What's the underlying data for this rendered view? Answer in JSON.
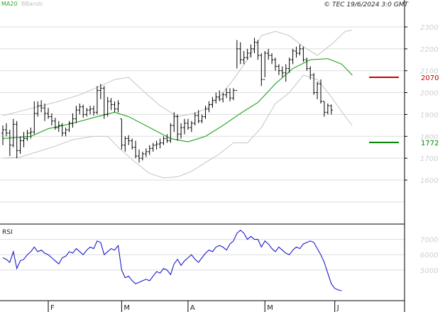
{
  "chart_data": {
    "type": "stock-chart",
    "legend": [
      {
        "label": "MA20",
        "color": "#2ea82e"
      },
      {
        "label": "BBands",
        "color": "#bfbfbf"
      }
    ],
    "header": "© TEC 19/6/2024 3:0 GMT",
    "price_axis": {
      "ticks": [
        1600,
        1700,
        1800,
        1900,
        2000,
        2100,
        2200,
        2300
      ],
      "ylim": [
        1490,
        2340
      ]
    },
    "x_axis": {
      "ticks": [
        "F",
        "M",
        "A",
        "M",
        "J"
      ],
      "tick_index": [
        13,
        34,
        53,
        75,
        95
      ],
      "n_bars": 105
    },
    "levels": [
      {
        "value": 2070,
        "label": "2070",
        "color": "#cc0000"
      },
      {
        "value": 1772,
        "label": "1772",
        "color": "#008000"
      }
    ],
    "rsi": {
      "label": "RSI",
      "ticks": [
        5000,
        6000,
        7000
      ],
      "ylim": [
        3000,
        8000
      ]
    },
    "bars": [
      {
        "o": 1815,
        "h": 1850,
        "l": 1760,
        "c": 1830
      },
      {
        "o": 1830,
        "h": 1860,
        "l": 1800,
        "c": 1815
      },
      {
        "o": 1815,
        "h": 1830,
        "l": 1710,
        "c": 1760
      },
      {
        "o": 1760,
        "h": 1880,
        "l": 1750,
        "c": 1855
      },
      {
        "o": 1855,
        "h": 1870,
        "l": 1700,
        "c": 1735
      },
      {
        "o": 1735,
        "h": 1800,
        "l": 1720,
        "c": 1780
      },
      {
        "o": 1780,
        "h": 1820,
        "l": 1750,
        "c": 1790
      },
      {
        "o": 1790,
        "h": 1830,
        "l": 1780,
        "c": 1815
      },
      {
        "o": 1815,
        "h": 1840,
        "l": 1790,
        "c": 1820
      },
      {
        "o": 1820,
        "h": 1960,
        "l": 1810,
        "c": 1905
      },
      {
        "o": 1905,
        "h": 1960,
        "l": 1890,
        "c": 1940
      },
      {
        "o": 1940,
        "h": 1965,
        "l": 1910,
        "c": 1930
      },
      {
        "o": 1930,
        "h": 1950,
        "l": 1870,
        "c": 1905
      },
      {
        "o": 1905,
        "h": 1930,
        "l": 1880,
        "c": 1890
      },
      {
        "o": 1890,
        "h": 1905,
        "l": 1850,
        "c": 1870
      },
      {
        "o": 1870,
        "h": 1885,
        "l": 1830,
        "c": 1840
      },
      {
        "o": 1840,
        "h": 1870,
        "l": 1820,
        "c": 1850
      },
      {
        "o": 1850,
        "h": 1860,
        "l": 1800,
        "c": 1815
      },
      {
        "o": 1815,
        "h": 1840,
        "l": 1800,
        "c": 1830
      },
      {
        "o": 1830,
        "h": 1870,
        "l": 1820,
        "c": 1860
      },
      {
        "o": 1860,
        "h": 1905,
        "l": 1840,
        "c": 1880
      },
      {
        "o": 1880,
        "h": 1940,
        "l": 1860,
        "c": 1920
      },
      {
        "o": 1920,
        "h": 1950,
        "l": 1900,
        "c": 1935
      },
      {
        "o": 1935,
        "h": 1945,
        "l": 1885,
        "c": 1900
      },
      {
        "o": 1900,
        "h": 1930,
        "l": 1890,
        "c": 1920
      },
      {
        "o": 1920,
        "h": 1940,
        "l": 1900,
        "c": 1925
      },
      {
        "o": 1925,
        "h": 1940,
        "l": 1895,
        "c": 1910
      },
      {
        "o": 1910,
        "h": 2030,
        "l": 1900,
        "c": 2010
      },
      {
        "o": 2010,
        "h": 2040,
        "l": 1970,
        "c": 2020
      },
      {
        "o": 2020,
        "h": 2030,
        "l": 1880,
        "c": 1900
      },
      {
        "o": 1900,
        "h": 1980,
        "l": 1890,
        "c": 1960
      },
      {
        "o": 1960,
        "h": 1975,
        "l": 1920,
        "c": 1945
      },
      {
        "o": 1945,
        "h": 1960,
        "l": 1910,
        "c": 1925
      },
      {
        "o": 1925,
        "h": 1965,
        "l": 1910,
        "c": 1950
      },
      {
        "o": 1880,
        "h": 1880,
        "l": 1740,
        "c": 1760
      },
      {
        "o": 1760,
        "h": 1800,
        "l": 1730,
        "c": 1790
      },
      {
        "o": 1790,
        "h": 1805,
        "l": 1760,
        "c": 1780
      },
      {
        "o": 1780,
        "h": 1790,
        "l": 1740,
        "c": 1750
      },
      {
        "o": 1750,
        "h": 1780,
        "l": 1700,
        "c": 1710
      },
      {
        "o": 1710,
        "h": 1740,
        "l": 1680,
        "c": 1700
      },
      {
        "o": 1700,
        "h": 1730,
        "l": 1690,
        "c": 1720
      },
      {
        "o": 1720,
        "h": 1745,
        "l": 1705,
        "c": 1730
      },
      {
        "o": 1730,
        "h": 1760,
        "l": 1715,
        "c": 1745
      },
      {
        "o": 1745,
        "h": 1770,
        "l": 1730,
        "c": 1760
      },
      {
        "o": 1760,
        "h": 1780,
        "l": 1740,
        "c": 1765
      },
      {
        "o": 1765,
        "h": 1790,
        "l": 1745,
        "c": 1770
      },
      {
        "o": 1770,
        "h": 1800,
        "l": 1760,
        "c": 1790
      },
      {
        "o": 1790,
        "h": 1810,
        "l": 1770,
        "c": 1780
      },
      {
        "o": 1780,
        "h": 1860,
        "l": 1770,
        "c": 1850
      },
      {
        "o": 1850,
        "h": 1910,
        "l": 1820,
        "c": 1890
      },
      {
        "o": 1890,
        "h": 1900,
        "l": 1780,
        "c": 1810
      },
      {
        "o": 1810,
        "h": 1860,
        "l": 1790,
        "c": 1840
      },
      {
        "o": 1840,
        "h": 1880,
        "l": 1810,
        "c": 1860
      },
      {
        "o": 1860,
        "h": 1880,
        "l": 1830,
        "c": 1840
      },
      {
        "o": 1840,
        "h": 1870,
        "l": 1820,
        "c": 1860
      },
      {
        "o": 1860,
        "h": 1910,
        "l": 1850,
        "c": 1895
      },
      {
        "o": 1895,
        "h": 1920,
        "l": 1860,
        "c": 1870
      },
      {
        "o": 1870,
        "h": 1900,
        "l": 1860,
        "c": 1890
      },
      {
        "o": 1890,
        "h": 1940,
        "l": 1880,
        "c": 1925
      },
      {
        "o": 1925,
        "h": 1960,
        "l": 1910,
        "c": 1945
      },
      {
        "o": 1945,
        "h": 1980,
        "l": 1930,
        "c": 1965
      },
      {
        "o": 1965,
        "h": 2000,
        "l": 1950,
        "c": 1980
      },
      {
        "o": 1980,
        "h": 2010,
        "l": 1960,
        "c": 1970
      },
      {
        "o": 1970,
        "h": 2000,
        "l": 1955,
        "c": 1990
      },
      {
        "o": 1990,
        "h": 2020,
        "l": 1975,
        "c": 2000
      },
      {
        "o": 2000,
        "h": 2020,
        "l": 1960,
        "c": 1975
      },
      {
        "o": 1975,
        "h": 2020,
        "l": 1965,
        "c": 2010
      },
      {
        "o": 2010,
        "h": 2240,
        "l": 2110,
        "c": 2200
      },
      {
        "o": 2200,
        "h": 2230,
        "l": 2130,
        "c": 2150
      },
      {
        "o": 2150,
        "h": 2190,
        "l": 2130,
        "c": 2160
      },
      {
        "o": 2160,
        "h": 2200,
        "l": 2150,
        "c": 2180
      },
      {
        "o": 2180,
        "h": 2220,
        "l": 2160,
        "c": 2200
      },
      {
        "o": 2200,
        "h": 2250,
        "l": 2180,
        "c": 2230
      },
      {
        "o": 2230,
        "h": 2240,
        "l": 2150,
        "c": 2170
      },
      {
        "o": 2170,
        "h": 2180,
        "l": 2030,
        "c": 2060
      },
      {
        "o": 2060,
        "h": 2190,
        "l": 2070,
        "c": 2180
      },
      {
        "o": 2180,
        "h": 2200,
        "l": 2150,
        "c": 2170
      },
      {
        "o": 2170,
        "h": 2180,
        "l": 2130,
        "c": 2150
      },
      {
        "o": 2150,
        "h": 2160,
        "l": 2100,
        "c": 2120
      },
      {
        "o": 2120,
        "h": 2130,
        "l": 2080,
        "c": 2100
      },
      {
        "o": 2100,
        "h": 2120,
        "l": 2070,
        "c": 2090
      },
      {
        "o": 2090,
        "h": 2130,
        "l": 2050,
        "c": 2110
      },
      {
        "o": 2110,
        "h": 2160,
        "l": 2090,
        "c": 2150
      },
      {
        "o": 2150,
        "h": 2200,
        "l": 2130,
        "c": 2190
      },
      {
        "o": 2190,
        "h": 2210,
        "l": 2160,
        "c": 2180
      },
      {
        "o": 2180,
        "h": 2220,
        "l": 2170,
        "c": 2200
      },
      {
        "o": 2200,
        "h": 2210,
        "l": 2140,
        "c": 2150
      },
      {
        "o": 2150,
        "h": 2160,
        "l": 2100,
        "c": 2110
      },
      {
        "o": 2110,
        "h": 2120,
        "l": 2060,
        "c": 2080
      },
      {
        "o": 2080,
        "h": 2090,
        "l": 1990,
        "c": 2000
      },
      {
        "o": 2000,
        "h": 2050,
        "l": 1970,
        "c": 2040
      },
      {
        "o": 2040,
        "h": 2060,
        "l": 1950,
        "c": 1960
      },
      {
        "o": 1960,
        "h": 1960,
        "l": 1890,
        "c": 1910
      },
      {
        "o": 1910,
        "h": 1950,
        "l": 1900,
        "c": 1940
      },
      {
        "o": 1940,
        "h": 1945,
        "l": 1900,
        "c": 1920
      }
    ],
    "ma20": [
      [
        0,
        1790
      ],
      [
        8,
        1800
      ],
      [
        13,
        1835
      ],
      [
        20,
        1860
      ],
      [
        27,
        1890
      ],
      [
        32,
        1910
      ],
      [
        36,
        1890
      ],
      [
        42,
        1840
      ],
      [
        48,
        1790
      ],
      [
        53,
        1775
      ],
      [
        58,
        1800
      ],
      [
        63,
        1850
      ],
      [
        68,
        1905
      ],
      [
        73,
        1955
      ],
      [
        78,
        2040
      ],
      [
        83,
        2110
      ],
      [
        88,
        2150
      ],
      [
        93,
        2155
      ],
      [
        97,
        2130
      ],
      [
        100,
        2080
      ]
    ],
    "bb_upper": [
      [
        0,
        1895
      ],
      [
        5,
        1915
      ],
      [
        10,
        1935
      ],
      [
        16,
        1960
      ],
      [
        22,
        1990
      ],
      [
        28,
        2030
      ],
      [
        32,
        2060
      ],
      [
        36,
        2070
      ],
      [
        40,
        2010
      ],
      [
        45,
        1940
      ],
      [
        50,
        1890
      ],
      [
        55,
        1905
      ],
      [
        58,
        1925
      ],
      [
        62,
        1980
      ],
      [
        66,
        2060
      ],
      [
        70,
        2150
      ],
      [
        74,
        2260
      ],
      [
        78,
        2280
      ],
      [
        82,
        2260
      ],
      [
        86,
        2210
      ],
      [
        90,
        2170
      ],
      [
        94,
        2220
      ],
      [
        98,
        2280
      ],
      [
        100,
        2285
      ]
    ],
    "bb_lower": [
      [
        0,
        1700
      ],
      [
        5,
        1705
      ],
      [
        10,
        1730
      ],
      [
        15,
        1755
      ],
      [
        20,
        1785
      ],
      [
        26,
        1800
      ],
      [
        30,
        1800
      ],
      [
        33,
        1750
      ],
      [
        38,
        1680
      ],
      [
        42,
        1630
      ],
      [
        46,
        1610
      ],
      [
        50,
        1615
      ],
      [
        54,
        1640
      ],
      [
        58,
        1680
      ],
      [
        62,
        1720
      ],
      [
        66,
        1770
      ],
      [
        70,
        1770
      ],
      [
        74,
        1840
      ],
      [
        78,
        1950
      ],
      [
        82,
        2000
      ],
      [
        86,
        2080
      ],
      [
        90,
        2060
      ],
      [
        94,
        1980
      ],
      [
        98,
        1890
      ],
      [
        100,
        1850
      ]
    ],
    "rsi_values": [
      [
        0,
        5800
      ],
      [
        1,
        5700
      ],
      [
        2,
        5500
      ],
      [
        3,
        6200
      ],
      [
        4,
        5100
      ],
      [
        5,
        5600
      ],
      [
        6,
        5700
      ],
      [
        7,
        6000
      ],
      [
        8,
        6200
      ],
      [
        9,
        6500
      ],
      [
        10,
        6200
      ],
      [
        11,
        6300
      ],
      [
        12,
        6100
      ],
      [
        13,
        6000
      ],
      [
        14,
        5800
      ],
      [
        15,
        5600
      ],
      [
        16,
        5400
      ],
      [
        17,
        5800
      ],
      [
        18,
        5900
      ],
      [
        19,
        6200
      ],
      [
        20,
        6100
      ],
      [
        21,
        6400
      ],
      [
        22,
        6200
      ],
      [
        23,
        6000
      ],
      [
        24,
        6300
      ],
      [
        25,
        6500
      ],
      [
        26,
        6400
      ],
      [
        27,
        6900
      ],
      [
        28,
        6800
      ],
      [
        29,
        6000
      ],
      [
        30,
        6200
      ],
      [
        31,
        6400
      ],
      [
        32,
        6300
      ],
      [
        33,
        6600
      ],
      [
        34,
        5000
      ],
      [
        35,
        4500
      ],
      [
        36,
        4600
      ],
      [
        37,
        4300
      ],
      [
        38,
        4100
      ],
      [
        39,
        4200
      ],
      [
        40,
        4300
      ],
      [
        41,
        4400
      ],
      [
        42,
        4300
      ],
      [
        43,
        4600
      ],
      [
        44,
        4900
      ],
      [
        45,
        4800
      ],
      [
        46,
        5100
      ],
      [
        47,
        5000
      ],
      [
        48,
        4700
      ],
      [
        49,
        5400
      ],
      [
        50,
        5700
      ],
      [
        51,
        5300
      ],
      [
        52,
        5600
      ],
      [
        53,
        5800
      ],
      [
        54,
        6000
      ],
      [
        55,
        5700
      ],
      [
        56,
        5500
      ],
      [
        57,
        5800
      ],
      [
        58,
        6100
      ],
      [
        59,
        6300
      ],
      [
        60,
        6200
      ],
      [
        61,
        6500
      ],
      [
        62,
        6600
      ],
      [
        63,
        6500
      ],
      [
        64,
        6300
      ],
      [
        65,
        6700
      ],
      [
        66,
        6900
      ],
      [
        67,
        7400
      ],
      [
        68,
        7600
      ],
      [
        69,
        7400
      ],
      [
        70,
        7000
      ],
      [
        71,
        7200
      ],
      [
        72,
        7000
      ],
      [
        73,
        7000
      ],
      [
        74,
        6500
      ],
      [
        75,
        6900
      ],
      [
        76,
        6700
      ],
      [
        77,
        6400
      ],
      [
        78,
        6200
      ],
      [
        79,
        6500
      ],
      [
        80,
        6300
      ],
      [
        81,
        6100
      ],
      [
        82,
        6000
      ],
      [
        83,
        6300
      ],
      [
        84,
        6500
      ],
      [
        85,
        6400
      ],
      [
        86,
        6700
      ],
      [
        87,
        6800
      ],
      [
        88,
        6900
      ],
      [
        89,
        6800
      ],
      [
        90,
        6400
      ],
      [
        91,
        6000
      ],
      [
        92,
        5500
      ],
      [
        93,
        4800
      ],
      [
        94,
        4100
      ],
      [
        95,
        3800
      ],
      [
        96,
        3700
      ],
      [
        97,
        3650
      ]
    ]
  }
}
